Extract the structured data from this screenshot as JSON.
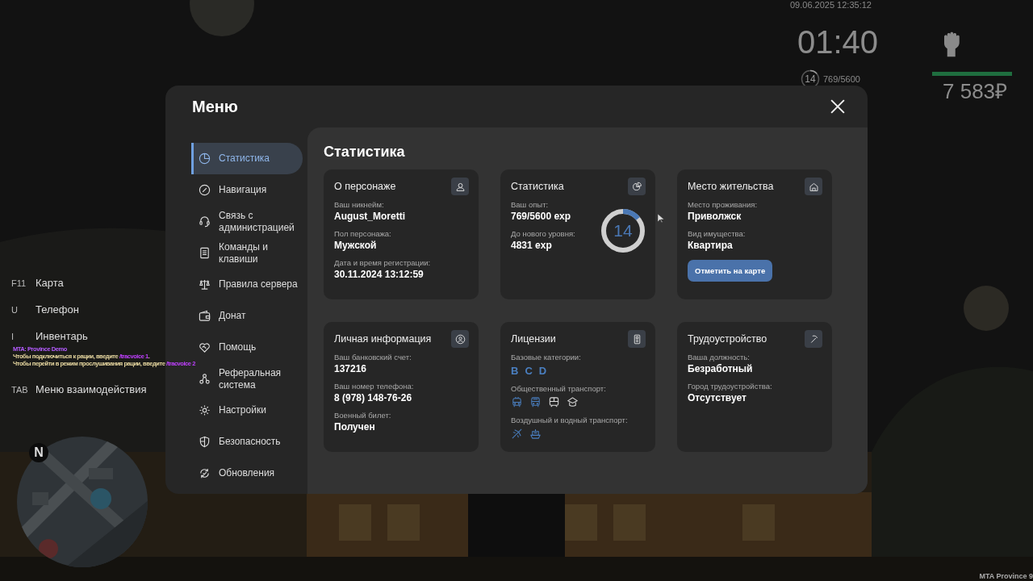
{
  "hud": {
    "datetime": "09.06.2025 12:35:12",
    "clock": "01:40",
    "rank": {
      "value": "14",
      "level": 0.14
    },
    "exp": "769/5600",
    "health": {
      "level": 1
    },
    "money": "7 583₽"
  },
  "hotkeys": [
    {
      "key": "F11",
      "label": "Карта"
    },
    {
      "key": "U",
      "label": "Телефон"
    },
    {
      "key": "I",
      "label": "Инвентарь"
    },
    {
      "key": "TAB",
      "label": "Меню взаимодействия"
    }
  ],
  "chat": [
    {
      "kind": "title",
      "text": "MTA: Province Demo"
    },
    {
      "kind": "message",
      "text": "Чтобы подключиться к рации, введите ",
      "command": "/tracvoice 1",
      "end": "."
    },
    {
      "kind": "message",
      "text": "Чтобы перейти в режим прослушивания рации, введите ",
      "command": "/tracvoice 2"
    }
  ],
  "minimap": {
    "north": "N"
  },
  "watermark": "MTA Province 9",
  "menu": {
    "title": "Меню",
    "nav": [
      {
        "label": "Статистика",
        "selected": true
      },
      {
        "label": "Навигация",
        "selected": false
      },
      {
        "label": "Связь с администрацией",
        "selected": false
      },
      {
        "label": "Команды и клавиши",
        "selected": false
      },
      {
        "label": "Правила сервера",
        "selected": false
      },
      {
        "label": "Донат",
        "selected": false
      },
      {
        "label": "Помощь",
        "selected": false
      },
      {
        "label": "Реферальная система",
        "selected": false
      },
      {
        "label": "Настройки",
        "selected": false
      },
      {
        "label": "Безопасность",
        "selected": false
      },
      {
        "label": "Обновления",
        "selected": false
      }
    ],
    "content_title": "Статистика",
    "cards": [
      {
        "kind": "info",
        "title": "О персонаже",
        "fields": [
          {
            "label": "Ваш никнейм:",
            "value": "August_Moretti"
          },
          {
            "label": "Пол персонажа:",
            "value": "Мужской"
          },
          {
            "label": "Дата и время регистрации:",
            "value": "30.11.2024 13:12:59"
          }
        ]
      },
      {
        "kind": "stats",
        "title": "Статистика",
        "fields": [
          {
            "label": "Ваш опыт:",
            "value": "769/5600 exp"
          },
          {
            "label": "До нового уровня:",
            "value": "4831 exp"
          }
        ],
        "ring": {
          "value": "14",
          "level": 0.14
        }
      },
      {
        "kind": "info",
        "title": "Место жительства",
        "fields": [
          {
            "label": "Место проживания:",
            "value": "Приволжск"
          },
          {
            "label": "Вид имущества:",
            "value": "Квартира"
          }
        ],
        "button": "Отметить на карте"
      },
      {
        "kind": "info",
        "title": "Личная информация",
        "fields": [
          {
            "label": "Ваш банковский счет:",
            "value": "137216"
          },
          {
            "label": "Ваш номер телефона:",
            "value": "8 (978) 148-76-26"
          },
          {
            "label": "Военный билет:",
            "value": "Получен"
          }
        ]
      },
      {
        "kind": "licenses",
        "title": "Лицензии",
        "groups": [
          {
            "kind": "letters",
            "label": "Базовые категории:",
            "items": [
              {
                "text": "B",
                "held": true
              },
              {
                "text": "C",
                "held": true
              },
              {
                "text": "D",
                "held": true
              }
            ]
          },
          {
            "kind": "icons",
            "label": "Общественный транспорт:",
            "items": [
              {
                "held": true
              },
              {
                "held": true
              },
              {
                "held": false
              },
              {
                "held": false
              }
            ]
          },
          {
            "kind": "icons",
            "label": "Воздушный и водный транспорт:",
            "items": [
              {
                "held": true
              },
              {
                "held": true
              }
            ]
          }
        ]
      },
      {
        "kind": "info",
        "title": "Трудоустройство",
        "fields": [
          {
            "label": "Ваша должность:",
            "value": "Безработный"
          },
          {
            "label": "Город трудоустройства:",
            "value": "Отсутствует"
          }
        ]
      }
    ]
  }
}
